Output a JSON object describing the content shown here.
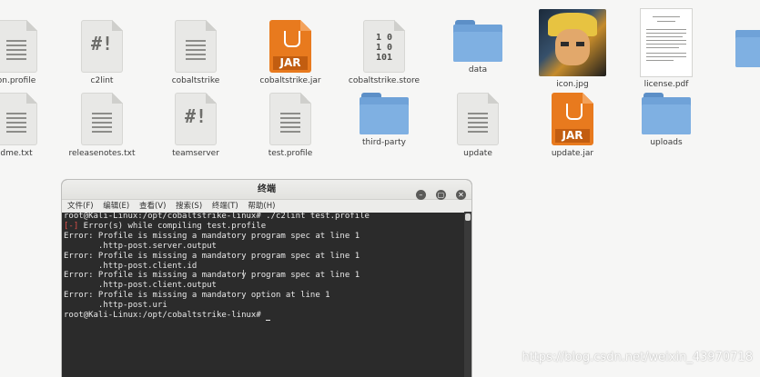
{
  "files_row1": [
    {
      "label": "on.profile",
      "kind": "doc-lines"
    },
    {
      "label": "c2lint",
      "kind": "doc-glyph",
      "glyph": "#!"
    },
    {
      "label": "cobaltstrike",
      "kind": "doc-lines"
    },
    {
      "label": "cobaltstrike.jar",
      "kind": "jar",
      "badge": "JAR"
    },
    {
      "label": "cobaltstrike.store",
      "kind": "doc-bin",
      "glyph": "1 0\n1 0\n101"
    },
    {
      "label": "data",
      "kind": "folder"
    },
    {
      "label": "icon.jpg",
      "kind": "image"
    },
    {
      "label": "license.pdf",
      "kind": "pdf"
    }
  ],
  "files_row2": [
    {
      "label": "dme.txt",
      "kind": "doc-lines"
    },
    {
      "label": "releasenotes.txt",
      "kind": "doc-lines"
    },
    {
      "label": "teamserver",
      "kind": "doc-glyph",
      "glyph": "#!"
    },
    {
      "label": "test.profile",
      "kind": "doc-lines"
    },
    {
      "label": "third-party",
      "kind": "folder"
    },
    {
      "label": "update",
      "kind": "doc-lines"
    },
    {
      "label": "update.jar",
      "kind": "jar",
      "badge": "JAR"
    },
    {
      "label": "uploads",
      "kind": "folder"
    }
  ],
  "terminal": {
    "title": "终端",
    "menu": [
      "文件(F)",
      "编辑(E)",
      "查看(V)",
      "搜索(S)",
      "终端(T)",
      "帮助(H)"
    ],
    "lines": [
      {
        "text": "root@Kali-Linux:/opt/cobaltstrike-linux# ./c2lint test.profile"
      },
      {
        "prefix": "[-]",
        "text": " Error(s) while compiling test.profile"
      },
      {
        "text": "Error: Profile is missing a mandatory program spec at line 1"
      },
      {
        "text": "       .http-post.server.output"
      },
      {
        "text": "Error: Profile is missing a mandatory program spec at line 1"
      },
      {
        "text": "       .http-post.client.id"
      },
      {
        "text": "Error: Profile is missing a mandatory program spec at line 1"
      },
      {
        "text": "       .http-post.client.output"
      },
      {
        "text": "Error: Profile is missing a mandatory option at line 1"
      },
      {
        "text": "       .http-post.uri"
      },
      {
        "text": "root@Kali-Linux:/opt/cobaltstrike-linux# "
      }
    ]
  },
  "watermark": "https://blog.csdn.net/weixin_43970718"
}
